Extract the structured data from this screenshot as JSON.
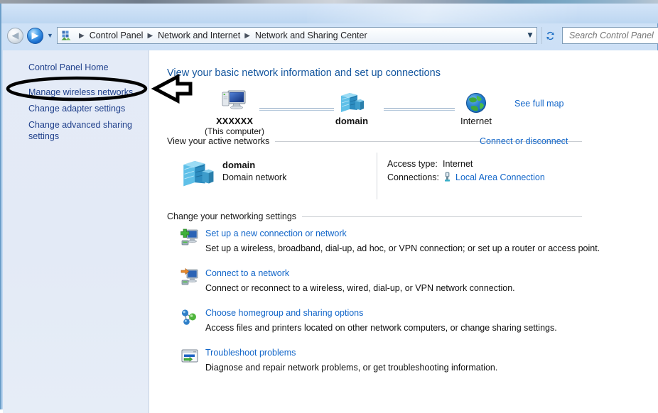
{
  "window": {
    "nav": {
      "back_label": "Back",
      "forward_label": "Forward",
      "recent_pages_label": "Recent pages",
      "refresh_label": "Refresh",
      "cp_icon": "control-panel-icon",
      "dropdown_icon": "chevron-down-icon",
      "refresh_icon": "refresh-icon"
    },
    "breadcrumb": {
      "items": [
        "Control Panel",
        "Network and Internet",
        "Network and Sharing Center"
      ],
      "separator": "▶"
    },
    "search": {
      "placeholder": "Search Control Panel",
      "value": ""
    }
  },
  "sidebar": {
    "items": [
      {
        "label": "Control Panel Home",
        "name": "sidebar-item-home"
      },
      {
        "label": "Manage wireless networks",
        "name": "sidebar-item-wireless"
      },
      {
        "label": "Change adapter settings",
        "name": "sidebar-item-adapter"
      },
      {
        "label": "Change advanced sharing settings",
        "name": "sidebar-item-advanced"
      }
    ]
  },
  "main": {
    "page_title": "View your basic network information and set up connections",
    "see_full_map": "See full map",
    "network_map": {
      "computer": {
        "label": "XXXXXX",
        "sub": "(This computer)",
        "icon": "computer-icon"
      },
      "domain": {
        "label": "domain",
        "icon": "server-icon"
      },
      "internet": {
        "label": "Internet",
        "icon": "globe-icon"
      }
    },
    "active_networks": {
      "heading": "View your active networks",
      "action_link": "Connect or disconnect",
      "network": {
        "name": "domain",
        "type": "Domain network",
        "icon": "server-icon",
        "access_type_label": "Access type:",
        "access_type_value": "Internet",
        "connections_label": "Connections:",
        "connection_name": "Local Area Connection",
        "connection_icon": "network-adapter-icon"
      }
    },
    "change_settings": {
      "heading": "Change your networking settings",
      "items": [
        {
          "title": "Set up a new connection or network",
          "desc": "Set up a wireless, broadband, dial-up, ad hoc, or VPN connection; or set up a router or access point.",
          "icon": "new-connection-icon"
        },
        {
          "title": "Connect to a network",
          "desc": "Connect or reconnect to a wireless, wired, dial-up, or VPN network connection.",
          "icon": "connect-network-icon"
        },
        {
          "title": "Choose homegroup and sharing options",
          "desc": "Access files and printers located on other network computers, or change sharing settings.",
          "icon": "homegroup-icon"
        },
        {
          "title": "Troubleshoot problems",
          "desc": "Diagnose and repair network problems, or get troubleshooting information.",
          "icon": "troubleshoot-icon"
        }
      ]
    }
  },
  "annotations": {
    "highlight_ellipse": {
      "target": "Manage wireless networks",
      "shape": "ellipse",
      "color": "#000000"
    },
    "pointer_arrow": {
      "direction": "left",
      "shape": "block-arrow",
      "color": "#000000"
    }
  },
  "colors": {
    "link": "#1266c9",
    "sidebar_link": "#21418c",
    "title": "#14569e",
    "glass": "#c6dcf4",
    "annotation": "#000000"
  }
}
